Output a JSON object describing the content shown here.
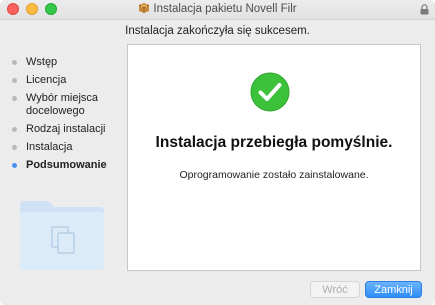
{
  "window": {
    "title": "Instalacja pakietu Novell Filr"
  },
  "subtitle": "Instalacja zakończyła się sukcesem.",
  "sidebar": {
    "steps": [
      {
        "label": "Wstęp",
        "active": false
      },
      {
        "label": "Licencja",
        "active": false
      },
      {
        "label": "Wybór miejsca docelowego",
        "active": false
      },
      {
        "label": "Rodzaj instalacji",
        "active": false
      },
      {
        "label": "Instalacja",
        "active": false
      },
      {
        "label": "Podsumowanie",
        "active": true
      }
    ]
  },
  "content": {
    "headline": "Instalacja przebiegła pomyślnie.",
    "message": "Oprogramowanie zostało zainstalowane."
  },
  "buttons": {
    "back": "Wróć",
    "close": "Zamknij"
  },
  "colors": {
    "success_green": "#3cc13b",
    "accent_blue": "#2d8ef7",
    "active_dot": "#4c8fef"
  },
  "icons": {
    "title": "package-icon",
    "lock": "lock-icon",
    "status": "checkmark-circle-icon",
    "illustration": "installer-folder-icon"
  }
}
